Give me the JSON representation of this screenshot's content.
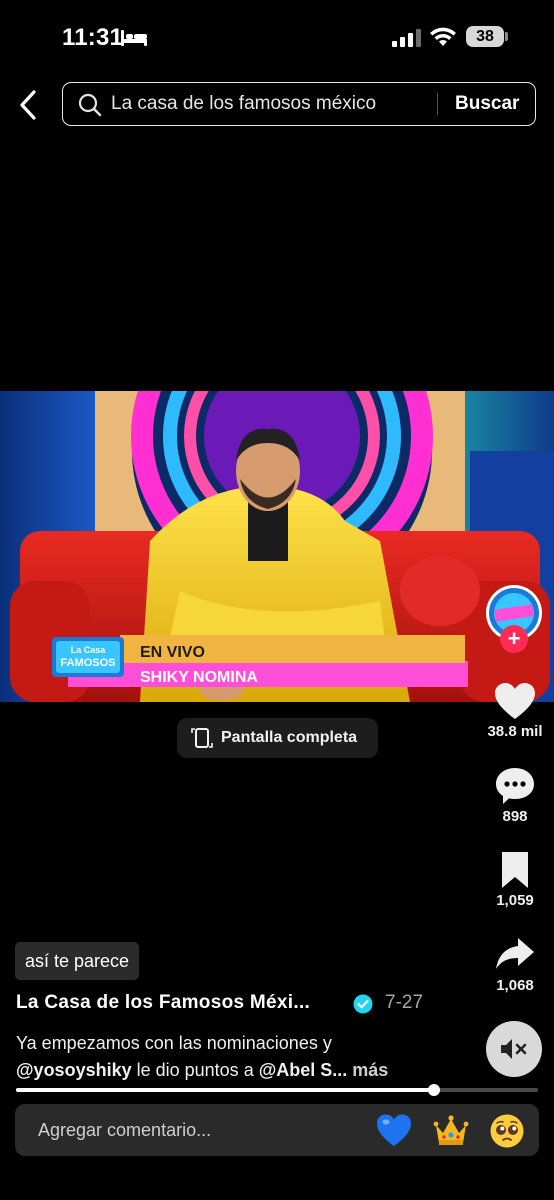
{
  "status_bar": {
    "time": "11:31",
    "battery": "38"
  },
  "search": {
    "query": "La casa de los famosos méxico",
    "button_label": "Buscar"
  },
  "video": {
    "show_logo_text": "La Casa de los FAMOSOS MÉXICO",
    "banner_line1": "EN VIVO",
    "banner_line2": "SHIKY NOMINA"
  },
  "fullscreen": {
    "label": "Pantalla completa"
  },
  "actions": {
    "likes": "38.8 mil",
    "comments": "898",
    "saves": "1,059",
    "shares": "1,068"
  },
  "post": {
    "tag_chip": "así te parece",
    "author": "La Casa de los Famosos Méxi...",
    "date": "7-27",
    "caption_line1": "Ya empezamos con las nominaciones y",
    "caption_mention1": "@yosoyshiky",
    "caption_mid": " le dio puntos a ",
    "caption_mention2": "@Abel S...",
    "caption_more": " más"
  },
  "playback": {
    "progress": 0.8
  },
  "comment_bar": {
    "placeholder": "Agregar comentario..."
  },
  "colors": {
    "accent": "#fe2c55",
    "verified": "#20d5ec",
    "banner_gold": "#f2b441",
    "banner_pink": "#ff4fd8"
  },
  "icons": [
    "bed-icon",
    "signal-icon",
    "wifi-icon",
    "back-icon",
    "search-icon",
    "fullscreen-icon",
    "heart-icon",
    "comment-icon",
    "bookmark-icon",
    "share-icon",
    "verified-icon",
    "mute-icon",
    "blue-heart-emoji",
    "crown-emoji",
    "pleading-face-emoji"
  ]
}
